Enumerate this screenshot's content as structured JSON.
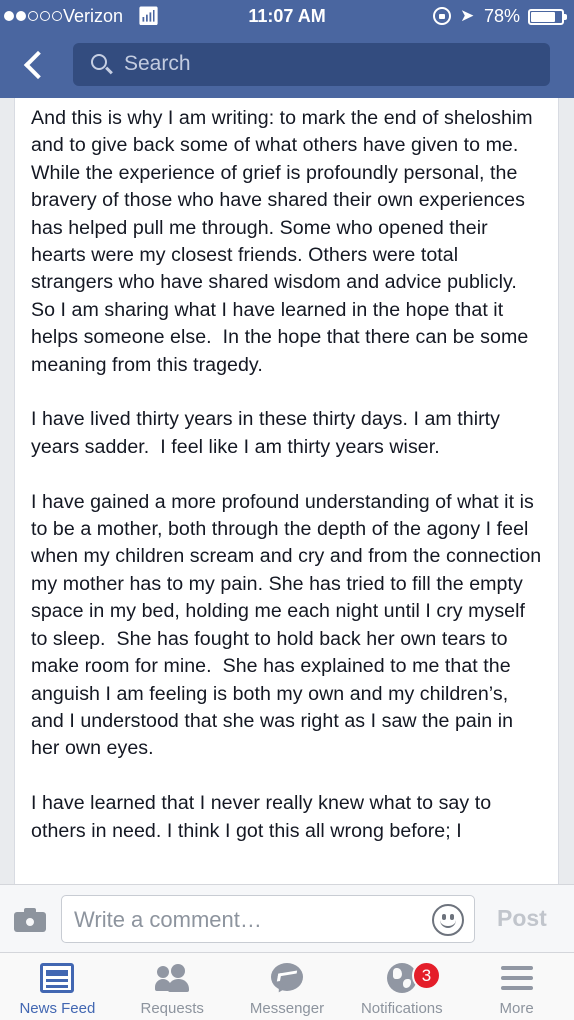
{
  "status_bar": {
    "carrier": "Verizon",
    "time": "11:07 AM",
    "battery": "78%",
    "battery_level": 0.78,
    "signal_bars_filled": 2,
    "signal_bars_total": 5
  },
  "header": {
    "search_placeholder": "Search",
    "accent_color": "#4a66a0"
  },
  "post": {
    "paragraphs": [
      "And this is why I am writing: to mark the end of sheloshim and to give back some of what others have given to me.  While the experience of grief is profoundly personal, the bravery of those who have shared their own experiences has helped pull me through. Some who opened their hearts were my closest friends. Others were total strangers who have shared wisdom and advice publicly. So I am sharing what I have learned in the hope that it helps someone else.  In the hope that there can be some meaning from this tragedy.",
      "I have lived thirty years in these thirty days. I am thirty years sadder.  I feel like I am thirty years wiser.",
      "I have gained a more profound understanding of what it is to be a mother, both through the depth of the agony I feel when my children scream and cry and from the connection my mother has to my pain. She has tried to fill the empty space in my bed, holding me each night until I cry myself to sleep.  She has fought to hold back her own tears to make room for mine.  She has explained to me that the anguish I am feeling is both my own and my children’s, and I understood that she was right as I saw the pain in her own eyes.",
      "I have learned that I never really knew what to say to others in need. I think I got this all wrong before; I"
    ]
  },
  "comment_bar": {
    "placeholder": "Write a comment…",
    "post_label": "Post"
  },
  "tabs": [
    {
      "label": "News Feed",
      "icon": "news-feed-icon",
      "active": true
    },
    {
      "label": "Requests",
      "icon": "requests-icon",
      "active": false
    },
    {
      "label": "Messenger",
      "icon": "messenger-icon",
      "active": false
    },
    {
      "label": "Notifications",
      "icon": "globe-icon",
      "active": false,
      "badge": "3"
    },
    {
      "label": "More",
      "icon": "menu-icon",
      "active": false
    }
  ]
}
